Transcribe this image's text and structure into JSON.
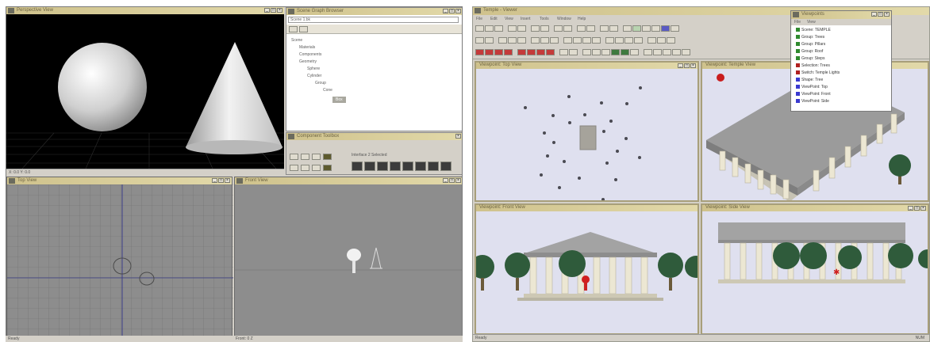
{
  "left_window": {
    "title": "Perspective View",
    "tree_title": "Scene Graph Browser",
    "tree_field": "Scene 1.bk",
    "tree_items": [
      "Scene",
      "Materials",
      "Components",
      "Geometry",
      "Sphere",
      "Cylinder",
      "Group",
      "Cone",
      "Box"
    ],
    "tree_selected": "Box",
    "toolbox_title": "Component Toolbox",
    "toolbox_text": "Interface 2 Selected",
    "status_top": "X: 0.0  Y: 0.0",
    "top_view_title": "Top View",
    "front_view_title": "Front View",
    "status_bottom_left": "Ready",
    "status_bottom_right": "Front: 0 Z"
  },
  "right_window": {
    "title": "Temple - Viewer",
    "menu_items": [
      "File",
      "Edit",
      "View",
      "Insert",
      "Tools",
      "Window",
      "Help"
    ],
    "viewports": [
      "Viewpoint: Top View",
      "Viewpoint: Temple View",
      "Viewpoint: Front View",
      "Viewpoint: Side View"
    ],
    "popup_title": "Viewpoints",
    "popup_menu": [
      "File",
      "View"
    ],
    "popup_items": [
      {
        "label": "Scene: TEMPLE",
        "color": "#2f8a2f"
      },
      {
        "label": "Group: Trees",
        "color": "#2f8a2f"
      },
      {
        "label": "Group: Pillars",
        "color": "#2f8a2f"
      },
      {
        "label": "Group: Roof",
        "color": "#2f8a2f"
      },
      {
        "label": "Group: Steps",
        "color": "#2f8a2f"
      },
      {
        "label": "Selection: Trees",
        "color": "#b02020"
      },
      {
        "label": "Switch: Temple Lights",
        "color": "#b02020"
      },
      {
        "label": "Shape: Tree",
        "color": "#3a3ad0"
      },
      {
        "label": "ViewPoint: Top",
        "color": "#3a3ad0"
      },
      {
        "label": "ViewPoint: Front",
        "color": "#3a3ad0"
      },
      {
        "label": "ViewPoint: Side",
        "color": "#3a3ad0"
      }
    ],
    "status_text": "Ready",
    "status_right": "NUM"
  },
  "colors": {
    "titlebar": "#d8cd9a",
    "chrome": "#d4d0c8",
    "viewport_bg": "#dfe0ef",
    "grid_bg": "#8d8d8d",
    "tree_green": "#2f5b3b",
    "column": "#e7e2cf",
    "roof": "#9a9a9a"
  }
}
